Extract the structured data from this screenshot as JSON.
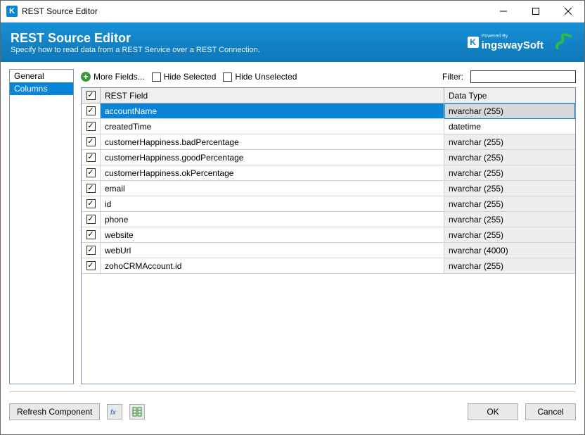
{
  "window": {
    "title": "REST Source Editor"
  },
  "banner": {
    "title": "REST Source Editor",
    "description": "Specify how to read data from a REST Service over a REST Connection.",
    "brand_powered": "Powered By",
    "brand_name": "ingswaySoft"
  },
  "sidebar": {
    "items": [
      {
        "label": "General",
        "selected": false
      },
      {
        "label": "Columns",
        "selected": true
      }
    ]
  },
  "toolbar": {
    "more_fields": "More Fields...",
    "hide_selected": "Hide Selected",
    "hide_unselected": "Hide Unselected",
    "filter_label": "Filter:",
    "filter_value": ""
  },
  "grid": {
    "header": {
      "field": "REST Field",
      "type": "Data Type"
    },
    "header_checked": true,
    "rows": [
      {
        "checked": true,
        "field": "accountName",
        "type": "nvarchar (255)",
        "selected": true,
        "type_white": false
      },
      {
        "checked": true,
        "field": "createdTime",
        "type": "datetime",
        "selected": false,
        "type_white": true
      },
      {
        "checked": true,
        "field": "customerHappiness.badPercentage",
        "type": "nvarchar (255)",
        "selected": false,
        "type_white": false
      },
      {
        "checked": true,
        "field": "customerHappiness.goodPercentage",
        "type": "nvarchar (255)",
        "selected": false,
        "type_white": false
      },
      {
        "checked": true,
        "field": "customerHappiness.okPercentage",
        "type": "nvarchar (255)",
        "selected": false,
        "type_white": false
      },
      {
        "checked": true,
        "field": "email",
        "type": "nvarchar (255)",
        "selected": false,
        "type_white": false
      },
      {
        "checked": true,
        "field": "id",
        "type": "nvarchar (255)",
        "selected": false,
        "type_white": false
      },
      {
        "checked": true,
        "field": "phone",
        "type": "nvarchar (255)",
        "selected": false,
        "type_white": false
      },
      {
        "checked": true,
        "field": "website",
        "type": "nvarchar (255)",
        "selected": false,
        "type_white": false
      },
      {
        "checked": true,
        "field": "webUrl",
        "type": "nvarchar (4000)",
        "selected": false,
        "type_white": false
      },
      {
        "checked": true,
        "field": "zohoCRMAccount.id",
        "type": "nvarchar (255)",
        "selected": false,
        "type_white": false
      }
    ]
  },
  "footer": {
    "refresh": "Refresh Component",
    "ok": "OK",
    "cancel": "Cancel"
  }
}
